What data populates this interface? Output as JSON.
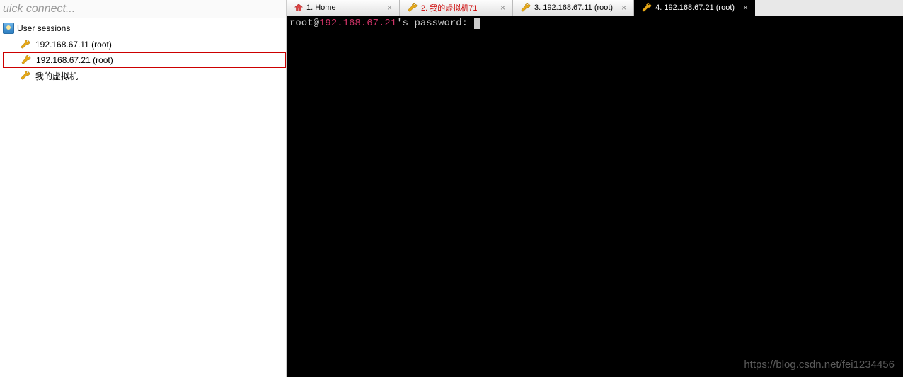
{
  "sidebar": {
    "quick_connect_placeholder": "uick connect...",
    "header_label": "User sessions",
    "items": [
      {
        "label": "192.168.67.11 (root)",
        "selected": false
      },
      {
        "label": "192.168.67.21 (root)",
        "selected": true
      },
      {
        "label": "我的虚拟机",
        "selected": false
      }
    ]
  },
  "tabs": [
    {
      "icon": "home",
      "label": "1. Home",
      "active": false,
      "red": false,
      "closable": true
    },
    {
      "icon": "wrench",
      "label": "2. 我的虚拟机71",
      "active": false,
      "red": true,
      "closable": true
    },
    {
      "icon": "wrench",
      "label": "3. 192.168.67.11 (root)",
      "active": false,
      "red": false,
      "closable": true
    },
    {
      "icon": "wrench",
      "label": "4. 192.168.67.21 (root)",
      "active": true,
      "red": false,
      "closable": true
    }
  ],
  "terminal": {
    "user": "root",
    "at": "@",
    "host": "192.168.67.21",
    "prompt_suffix": "'s password: "
  },
  "watermark": "https://blog.csdn.net/fei1234456"
}
